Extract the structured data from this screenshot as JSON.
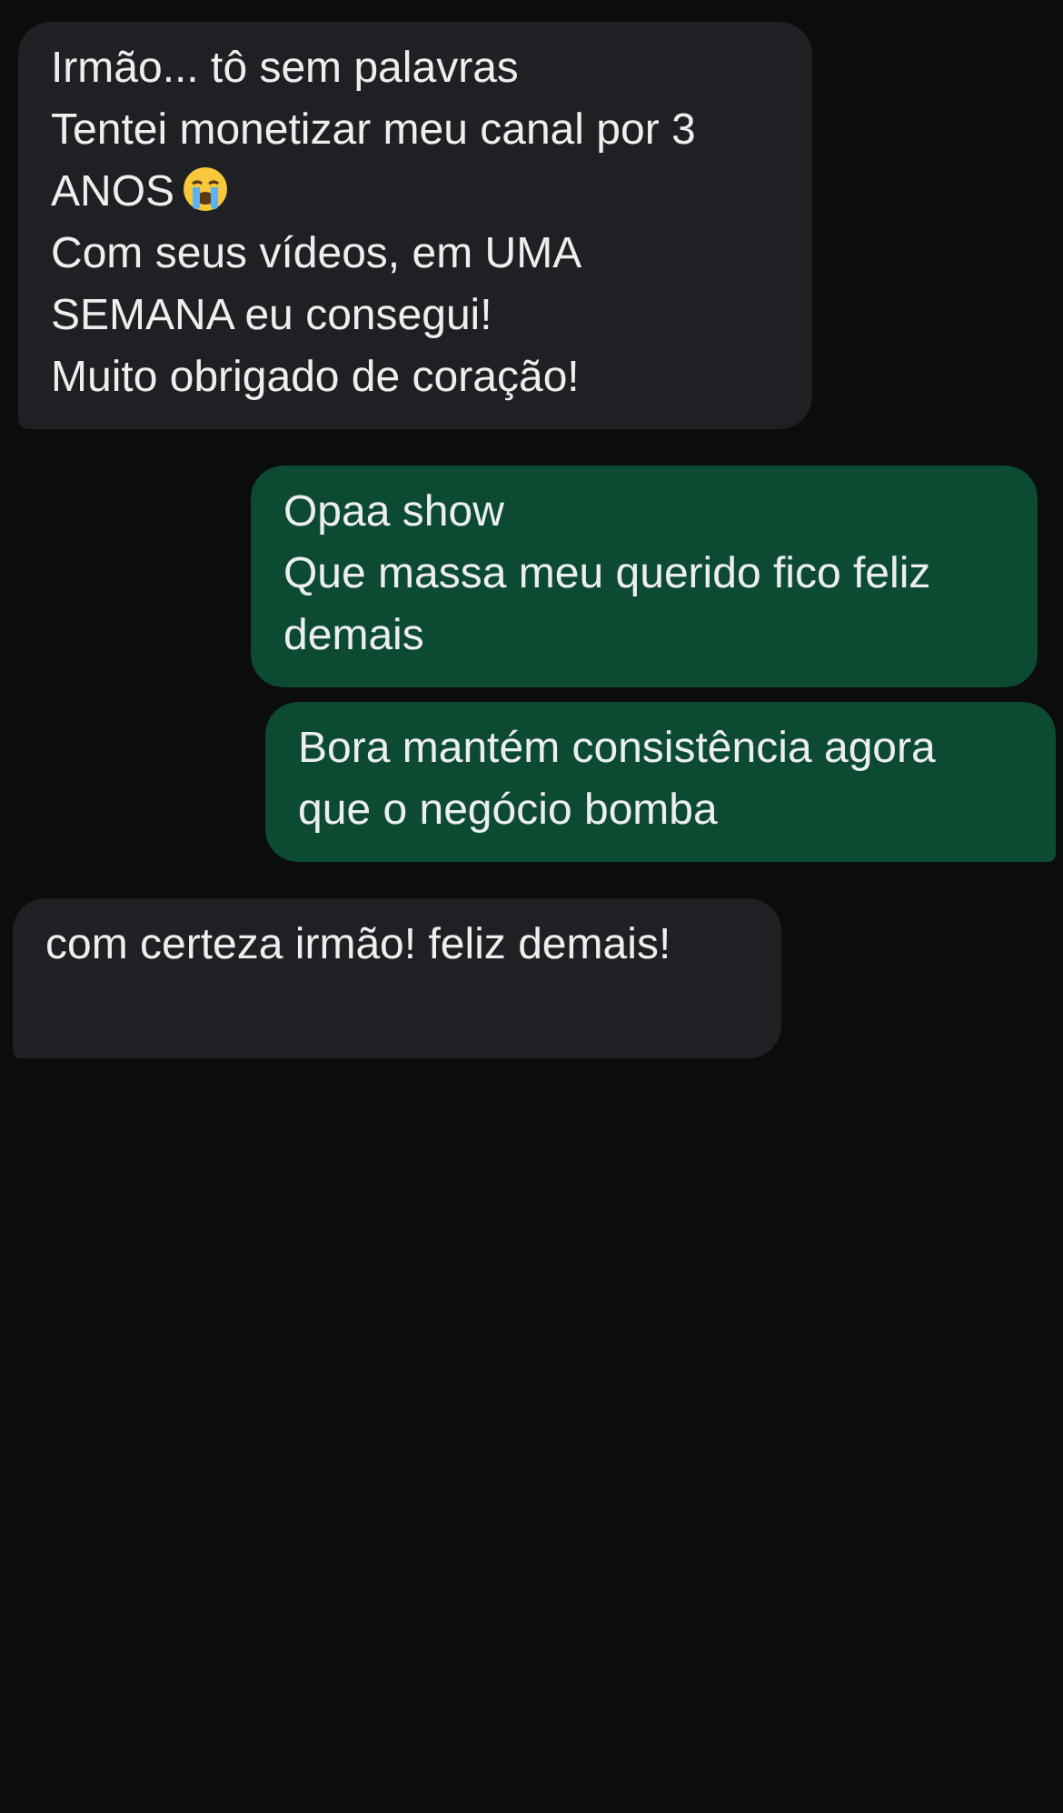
{
  "messages": [
    {
      "kind": "incoming",
      "lines": [
        {
          "text": "Irmão... tô sem palavras"
        },
        {
          "text": "Tentei monetizar meu canal por 3 ANOS",
          "crying_emoji": true
        },
        {
          "text": "Com seus vídeos, em UMA SEMANA eu consegui!"
        },
        {
          "text": "Muito obrigado de coração!"
        }
      ]
    },
    {
      "kind": "outgoing",
      "lines": [
        {
          "text": "Opaa show"
        },
        {
          "text": "Que massa meu querido fico feliz demais"
        }
      ]
    },
    {
      "kind": "outgoing",
      "tail": true,
      "lines": [
        {
          "text": "Bora mantém consistência agora que o negócio bomba"
        }
      ]
    },
    {
      "kind": "incoming",
      "tail": true,
      "lines": [
        {
          "text": "com certeza irmão! feliz demais!"
        }
      ]
    }
  ]
}
